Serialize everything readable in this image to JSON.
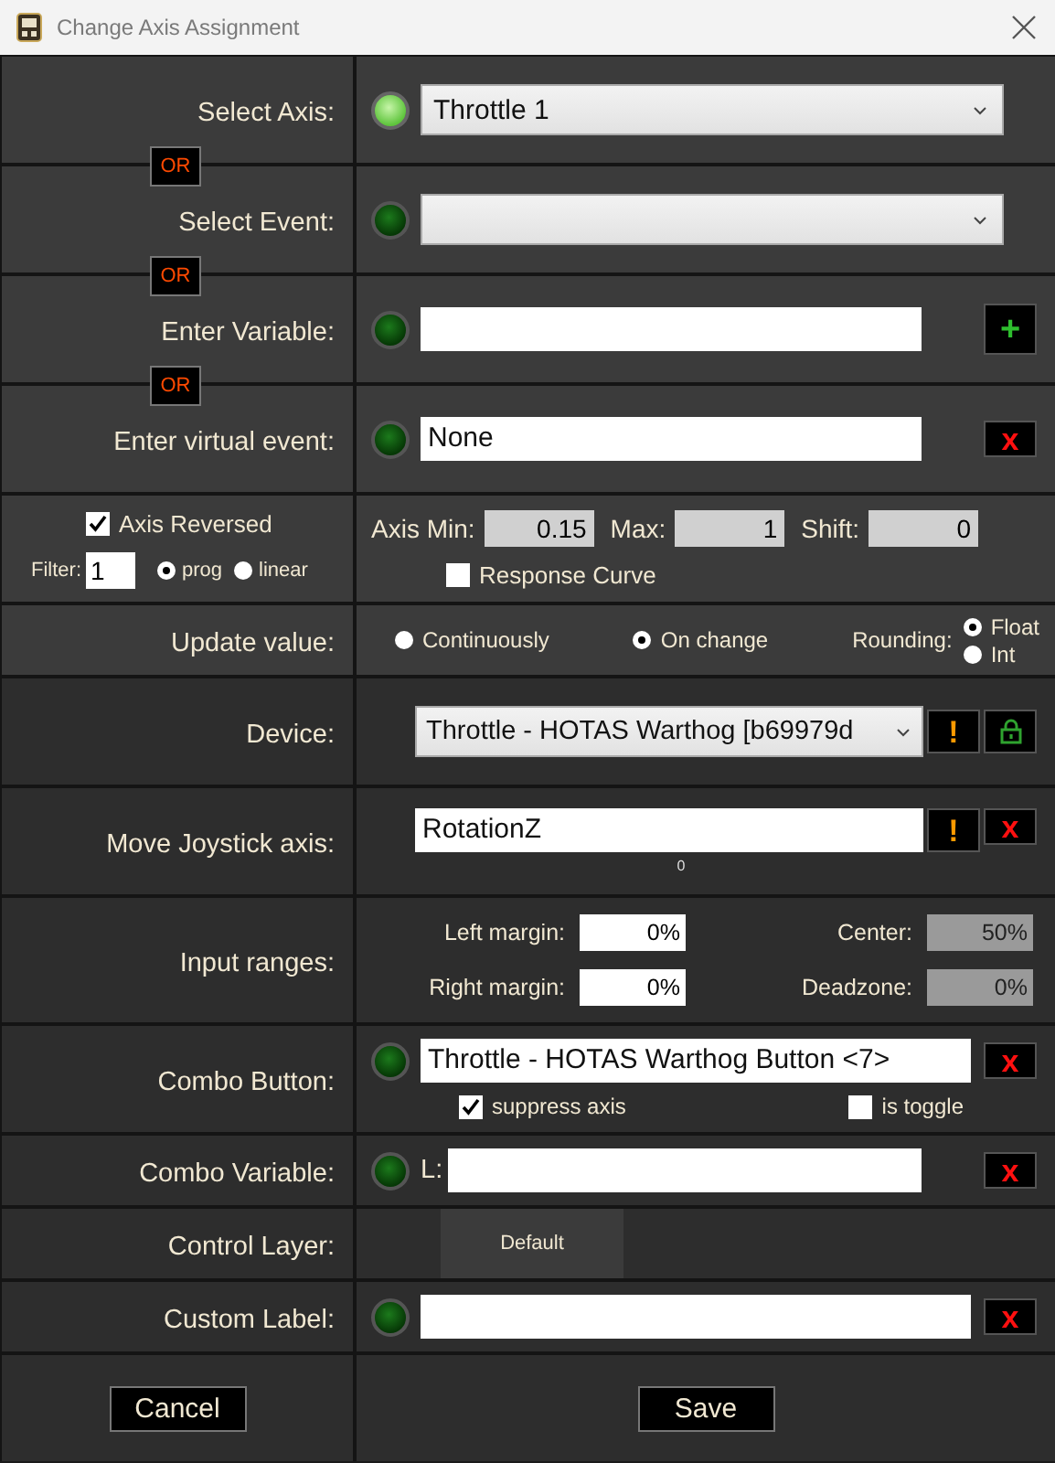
{
  "window": {
    "title": "Change Axis Assignment"
  },
  "rows": [
    {
      "kind": "dropdown",
      "label": "Select Axis:",
      "led_on": true,
      "value": "Throttle 1",
      "separator": "OR"
    },
    {
      "kind": "dropdown",
      "label": "Select Event:",
      "led_on": false,
      "separator": "OR"
    },
    {
      "kind": "text",
      "label": "Enter Variable:",
      "led_on": false,
      "buttons": [
        {
          "kind": "add",
          "glyph": "+"
        }
      ],
      "separator": "OR"
    },
    {
      "kind": "text",
      "label": "Enter virtual event:",
      "led_on": false,
      "value": "None",
      "buttons": [
        {
          "kind": "clear",
          "glyph": "x"
        }
      ]
    },
    {
      "kind": "axis",
      "reversed": {
        "label": "Axis Reversed",
        "checked": true
      },
      "filter": {
        "label": "Filter:",
        "value": "1"
      },
      "filter_modes": [
        {
          "label": "prog",
          "selected": true
        },
        {
          "label": "linear",
          "selected": false
        }
      ],
      "fields": [
        {
          "label": "Axis Min:",
          "value": "0.15"
        },
        {
          "label": "Max:",
          "value": "1"
        },
        {
          "label": "Shift:",
          "value": "0"
        }
      ],
      "response_curve": {
        "label": "Response Curve",
        "checked": false
      }
    },
    {
      "kind": "update",
      "label": "Update value:",
      "modes": [
        {
          "label": "Continuously",
          "selected": false
        },
        {
          "label": "On change",
          "selected": true
        }
      ],
      "rounding_label": "Rounding:",
      "rounding": [
        {
          "label": "Float",
          "selected": true
        },
        {
          "label": "Int",
          "selected": false
        }
      ]
    },
    {
      "kind": "device",
      "label": "Device:",
      "value": "Throttle - HOTAS Warthog [b69979d",
      "buttons": [
        {
          "kind": "warning",
          "glyph": "!"
        },
        {
          "kind": "lock"
        }
      ]
    },
    {
      "kind": "axis_name",
      "label": "Move Joystick axis:",
      "value": "RotationZ",
      "reading": "0",
      "buttons": [
        {
          "kind": "warning",
          "glyph": "!"
        },
        {
          "kind": "clear",
          "glyph": "x"
        }
      ]
    },
    {
      "kind": "ranges",
      "label": "Input ranges:",
      "fields": [
        {
          "label": "Left margin:",
          "value": "0%",
          "disabled": false
        },
        {
          "label": "Center:",
          "value": "50%",
          "disabled": true
        },
        {
          "label": "Right margin:",
          "value": "0%",
          "disabled": false
        },
        {
          "label": "Deadzone:",
          "value": "0%",
          "disabled": true
        }
      ]
    },
    {
      "kind": "combo",
      "label": "Combo Button:",
      "led_on": false,
      "value": "Throttle - HOTAS Warthog Button <7>",
      "buttons": [
        {
          "kind": "clear",
          "glyph": "x"
        }
      ],
      "options": [
        {
          "label": "suppress axis",
          "checked": true
        },
        {
          "label": "is toggle",
          "checked": false
        }
      ]
    },
    {
      "kind": "text",
      "label": "Combo Variable:",
      "led_on": false,
      "prefix": "L:",
      "buttons": [
        {
          "kind": "clear",
          "glyph": "x"
        }
      ]
    },
    {
      "kind": "layer",
      "label": "Control Layer:",
      "value": "Default"
    },
    {
      "kind": "text",
      "label": "Custom Label:",
      "led_on": false,
      "buttons": [
        {
          "kind": "clear",
          "glyph": "x"
        }
      ]
    },
    {
      "kind": "footer",
      "actions": [
        {
          "label": "Cancel"
        },
        {
          "label": "Save"
        }
      ]
    }
  ]
}
